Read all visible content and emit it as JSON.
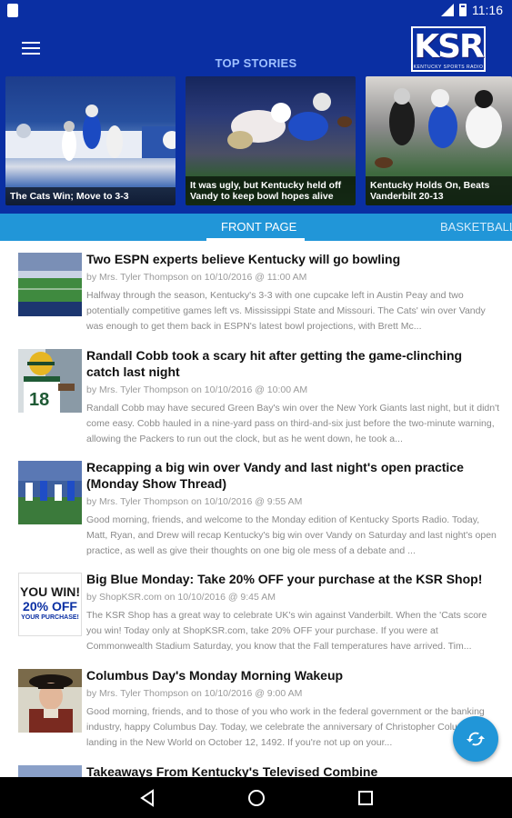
{
  "status_bar": {
    "time": "11:16"
  },
  "app_bar": {
    "title": "TOP STORIES",
    "logo_text": "KSR",
    "logo_subtitle": "KENTUCKY SPORTS RADIO"
  },
  "top_stories": [
    {
      "caption": "The Cats Win; Move to 3-3"
    },
    {
      "caption": "It was ugly, but Kentucky held off Vandy to keep bowl hopes alive"
    },
    {
      "caption": "Kentucky Holds On, Beats Vanderbilt 20-13"
    }
  ],
  "tabs": [
    {
      "label": "FRONT PAGE",
      "active": true
    },
    {
      "label": "BASKETBALL",
      "active": false
    }
  ],
  "articles": [
    {
      "title": "Two ESPN experts believe Kentucky will go bowling",
      "meta": "by Mrs. Tyler Thompson on 10/10/2016 @ 11:00 AM",
      "excerpt": "Halfway through the season, Kentucky's 3-3 with one cupcake left in Austin Peay and two potentially competitive games left vs. Mississippi State and Missouri. The Cats' win over Vandy was enough to get them back in ESPN's latest bowl projections, with Brett Mc..."
    },
    {
      "title": "Randall Cobb took a scary hit after getting the game-clinching catch last night",
      "meta": "by Mrs. Tyler Thompson on 10/10/2016 @ 10:00 AM",
      "excerpt": "Randall Cobb may have secured Green Bay's win over the New York Giants last night, but it didn't come easy. Cobb hauled in a nine-yard pass on third-and-six just before the two-minute warning, allowing the Packers to run out the clock, but as he went down, he took a..."
    },
    {
      "title": "Recapping a big win over Vandy and last night's open practice (Monday Show Thread)",
      "meta": "by Mrs. Tyler Thompson on 10/10/2016 @ 9:55 AM",
      "excerpt": "Good morning, friends, and welcome to the Monday edition of Kentucky Sports Radio. Today, Matt, Ryan, and Drew will recap Kentucky's big win over Vandy on Saturday and last night's open practice, as well as give their thoughts on one big ole mess of a debate and ..."
    },
    {
      "title": "Big Blue Monday: Take 20% OFF your purchase at the KSR Shop!",
      "meta": "by ShopKSR.com on 10/10/2016 @ 9:45 AM",
      "excerpt": "The KSR Shop has a great way to celebrate UK's win against Vanderbilt. When the 'Cats score you win!  Today only at ShopKSR.com, take 20% OFF your purchase.  If you were at Commonwealth Stadium Saturday, you know that the Fall temperatures have arrived. Tim...",
      "thumb_lines": [
        "YOU WIN!",
        "20% OFF",
        "YOUR PURCHASE!"
      ]
    },
    {
      "title": "Columbus Day's Monday Morning Wakeup",
      "meta": "by Mrs. Tyler Thompson on 10/10/2016 @ 9:00 AM",
      "excerpt": "Good morning, friends, and to those of you who work in the federal government or the banking industry, happy Columbus Day. Today, we celebrate the anniversary of Christopher Columbus' landing in the New World on October 12, 1492. If you're not up on your..."
    },
    {
      "title": "Takeaways From Kentucky's Televised Combine",
      "meta": "",
      "excerpt": ""
    }
  ],
  "icons": {
    "menu": "hamburger-icon",
    "refresh": "refresh-icon",
    "nav_back": "back-triangle-icon",
    "nav_home": "home-circle-icon",
    "nav_recents": "recents-square-icon"
  },
  "colors": {
    "primary": "#0a2fa3",
    "accent": "#2196d8",
    "title_text": "#111111",
    "meta_text": "#9a9a9a"
  }
}
